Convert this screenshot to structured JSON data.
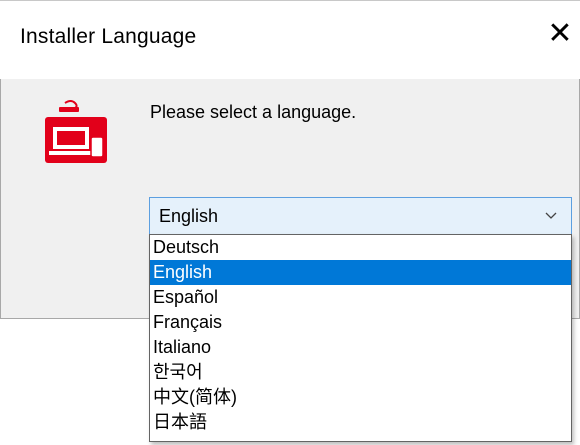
{
  "window": {
    "title": "Installer Language",
    "close_glyph": "✕"
  },
  "icon": {
    "name": "leica-installer-icon",
    "brand_color": "#e2001a"
  },
  "prompt": "Please select a language.",
  "language_select": {
    "selected": "English",
    "options": [
      "Deutsch",
      "English",
      "Español",
      "Français",
      "Italiano",
      "한국어",
      "中文(简体)",
      "日本語"
    ],
    "selected_index": 1
  },
  "colors": {
    "selection": "#0078d7",
    "field_background": "#e5f1fb",
    "field_border": "#5c9fe0"
  }
}
